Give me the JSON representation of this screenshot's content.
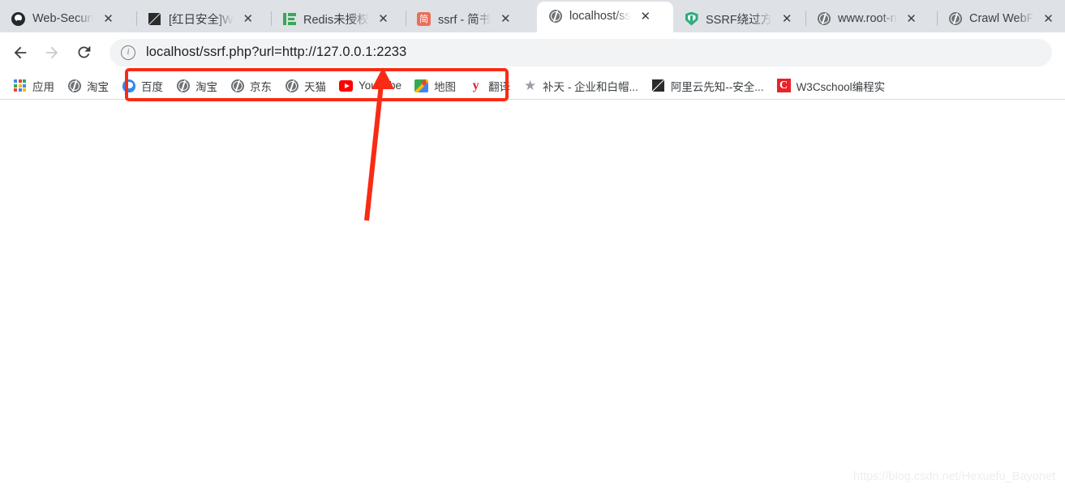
{
  "browser": {
    "tabs": [
      {
        "title": "Web-Securi",
        "favicon": "github-icon",
        "active": false
      },
      {
        "title": "[红日安全]W",
        "favicon": "slash-logo-icon",
        "active": false
      },
      {
        "title": "Redis未授权",
        "favicon": "redis-icon",
        "active": false
      },
      {
        "title": "ssrf - 简书",
        "favicon": "jianshu-icon",
        "active": false
      },
      {
        "title": "localhost/ss",
        "favicon": "globe-icon",
        "active": true
      },
      {
        "title": "SSRF绕过方",
        "favicon": "shield-icon",
        "active": false
      },
      {
        "title": "www.root-n",
        "favicon": "globe-icon",
        "active": false
      },
      {
        "title": "Crawl WebF",
        "favicon": "globe-icon",
        "active": false
      }
    ],
    "tab_close_glyph": "✕",
    "toolbar": {
      "back_label": "Back",
      "forward_label": "Forward",
      "reload_label": "Reload",
      "site_info_glyph": "i",
      "url": "localhost/ssrf.php?url=http://127.0.0.1:2233"
    },
    "bookmarks": [
      {
        "label": "应用",
        "icon": "apps-grid-icon"
      },
      {
        "label": "淘宝",
        "icon": "globe-icon"
      },
      {
        "label": "百度",
        "icon": "baidu-icon"
      },
      {
        "label": "淘宝",
        "icon": "globe-icon"
      },
      {
        "label": "京东",
        "icon": "globe-icon"
      },
      {
        "label": "天猫",
        "icon": "globe-icon"
      },
      {
        "label": "YouTube",
        "icon": "youtube-icon"
      },
      {
        "label": "地图",
        "icon": "google-maps-icon"
      },
      {
        "label": "翻译",
        "icon": "youdao-translate-icon"
      },
      {
        "label": "补天 - 企业和白帽...",
        "icon": "star-icon"
      },
      {
        "label": "阿里云先知--安全...",
        "icon": "slash-logo-icon"
      },
      {
        "label": "W3Cschool编程实",
        "icon": "w3cschool-icon"
      }
    ]
  },
  "page": {
    "body_text": "",
    "watermark": "https://blog.csdn.net/Hexuefu_Bayonet"
  },
  "annotations": {
    "highlight_box_color": "#f92b14",
    "arrow_color": "#f92b14",
    "arrow_target": "address-bar"
  }
}
